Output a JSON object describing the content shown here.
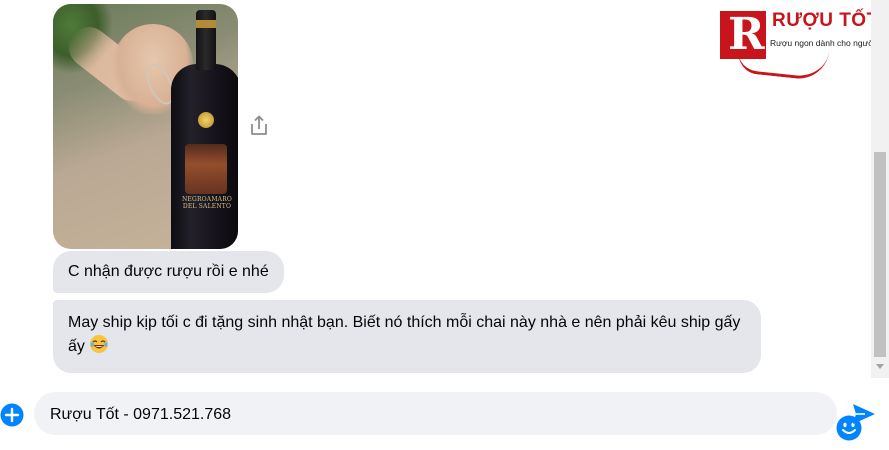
{
  "logo": {
    "brand": "RƯỢU TỐT",
    "mark": "R",
    "tagline": "Rượu ngon dành cho người sành",
    "color": "#c8141b"
  },
  "photo": {
    "label_line_1": "NEGROAMARO",
    "label_line_2": "DEL SALENTO"
  },
  "messages": [
    {
      "text": "C nhận được rượu rồi e nhé"
    },
    {
      "text": "May ship kịp tối c đi tặng sinh nhật bạn. Biết nó thích mỗi chai này nhà e nên phải kêu ship gấy ấy",
      "emoji": "😂"
    }
  ],
  "composer": {
    "value": "Rượu Tốt - 0971.521.768"
  },
  "icons": {
    "share": "share-icon",
    "plus": "plus-circle-icon",
    "emoji": "smiley-icon",
    "send": "send-icon"
  },
  "colors": {
    "accent": "#0084ff",
    "bubble": "#e4e6eb",
    "input_bg": "#f0f2f5"
  }
}
